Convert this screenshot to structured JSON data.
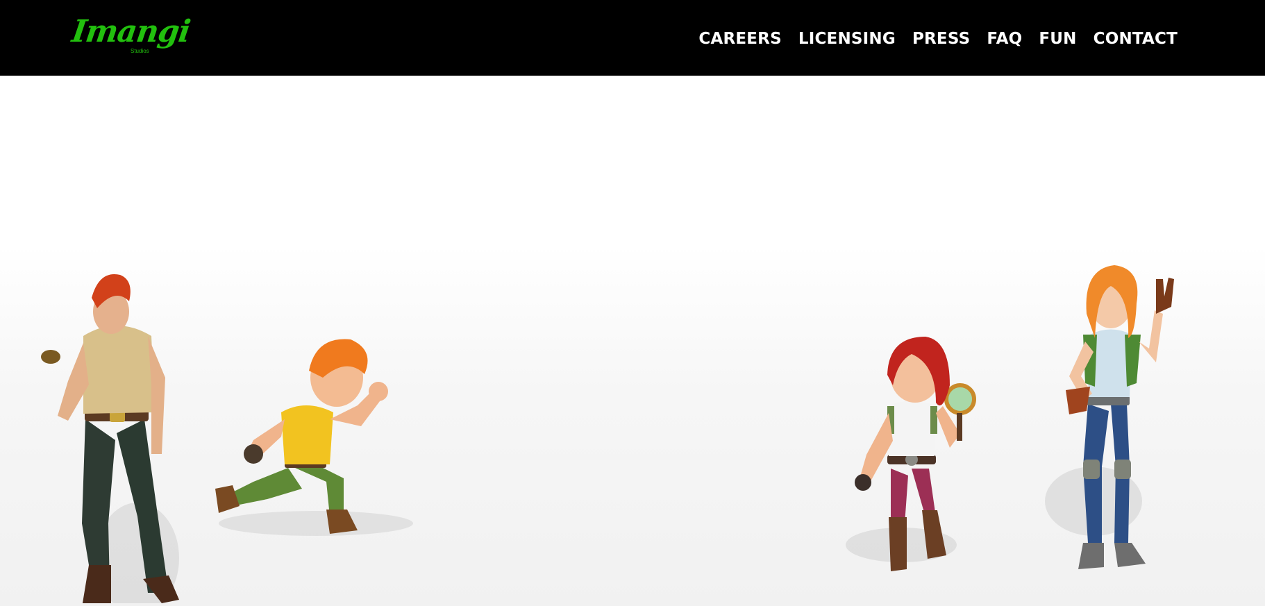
{
  "header": {
    "logo": {
      "wordmark": "Imangi",
      "sub": "Studios",
      "color": "#22c00e"
    },
    "nav": [
      {
        "label": "CAREERS"
      },
      {
        "label": "LICENSING"
      },
      {
        "label": "PRESS"
      },
      {
        "label": "FAQ"
      },
      {
        "label": "FUN"
      },
      {
        "label": "CONTACT"
      }
    ]
  },
  "hero": {
    "background_color": "#f3f3f3",
    "characters": [
      {
        "icon": "explorer-man-character-icon"
      },
      {
        "icon": "running-boy-character-icon"
      },
      {
        "icon": "redhead-girl-magnifier-character-icon"
      },
      {
        "icon": "waving-woman-character-icon"
      }
    ]
  }
}
